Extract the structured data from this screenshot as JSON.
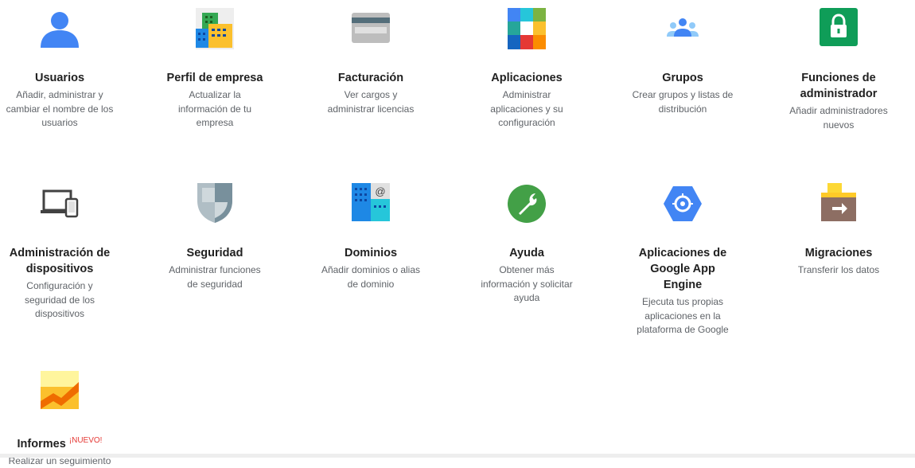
{
  "cards": [
    {
      "id": "usuarios",
      "title": "Usuarios",
      "desc": "Añadir, administrar y cambiar el nombre de los usuarios",
      "icon": "user-icon"
    },
    {
      "id": "perfil",
      "title": "Perfil de empresa",
      "desc": "Actualizar la información de tu empresa",
      "icon": "building-icon"
    },
    {
      "id": "facturacion",
      "title": "Facturación",
      "desc": "Ver cargos y administrar licencias",
      "icon": "credit-card-icon"
    },
    {
      "id": "aplicaciones",
      "title": "Aplicaciones",
      "desc": "Administrar aplicaciones y su configuración",
      "icon": "apps-grid-icon"
    },
    {
      "id": "grupos",
      "title": "Grupos",
      "desc": "Crear grupos y listas de distribución",
      "icon": "group-icon"
    },
    {
      "id": "funciones",
      "title": "Funciones de administrador",
      "desc": "Añadir administradores nuevos",
      "icon": "lock-icon"
    },
    {
      "id": "dispositivos",
      "title": "Administración de dispositivos",
      "desc": "Configuración y seguridad de los dispositivos",
      "icon": "devices-icon"
    },
    {
      "id": "seguridad",
      "title": "Seguridad",
      "desc": "Administrar funciones de seguridad",
      "icon": "shield-icon"
    },
    {
      "id": "dominios",
      "title": "Dominios",
      "desc": "Añadir dominios o alias de dominio",
      "icon": "domain-at-icon"
    },
    {
      "id": "ayuda",
      "title": "Ayuda",
      "desc": "Obtener más información y solicitar ayuda",
      "icon": "wrench-icon"
    },
    {
      "id": "appengine",
      "title": "Aplicaciones de Google App Engine",
      "desc": "Ejecuta tus propias aplicaciones en la plataforma de Google",
      "icon": "app-engine-icon"
    },
    {
      "id": "migraciones",
      "title": "Migraciones",
      "desc": "Transferir los datos",
      "icon": "migration-box-icon"
    },
    {
      "id": "informes",
      "title": "Informes",
      "desc": "Realizar un seguimiento",
      "icon": "reports-chart-icon",
      "badge": "¡NUEVO!"
    }
  ]
}
